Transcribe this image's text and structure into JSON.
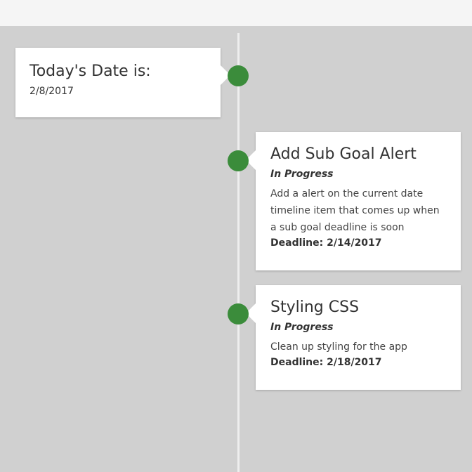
{
  "today": {
    "title": "Today's Date is:",
    "date": "2/8/2017"
  },
  "goals": [
    {
      "title": "Add Sub Goal Alert",
      "status": "In Progress",
      "description": "Add a alert on the current date timeline item that comes up when a sub goal deadline is soon",
      "deadline": "Deadline: 2/14/2017"
    },
    {
      "title": "Styling CSS",
      "status": "In Progress",
      "description": "Clean up styling for the app",
      "deadline": "Deadline: 2/18/2017"
    }
  ],
  "colors": {
    "background": "#d0d0d0",
    "topbar": "#f5f5f5",
    "timeline_dot": "#3b8c3b",
    "card": "#ffffff"
  }
}
